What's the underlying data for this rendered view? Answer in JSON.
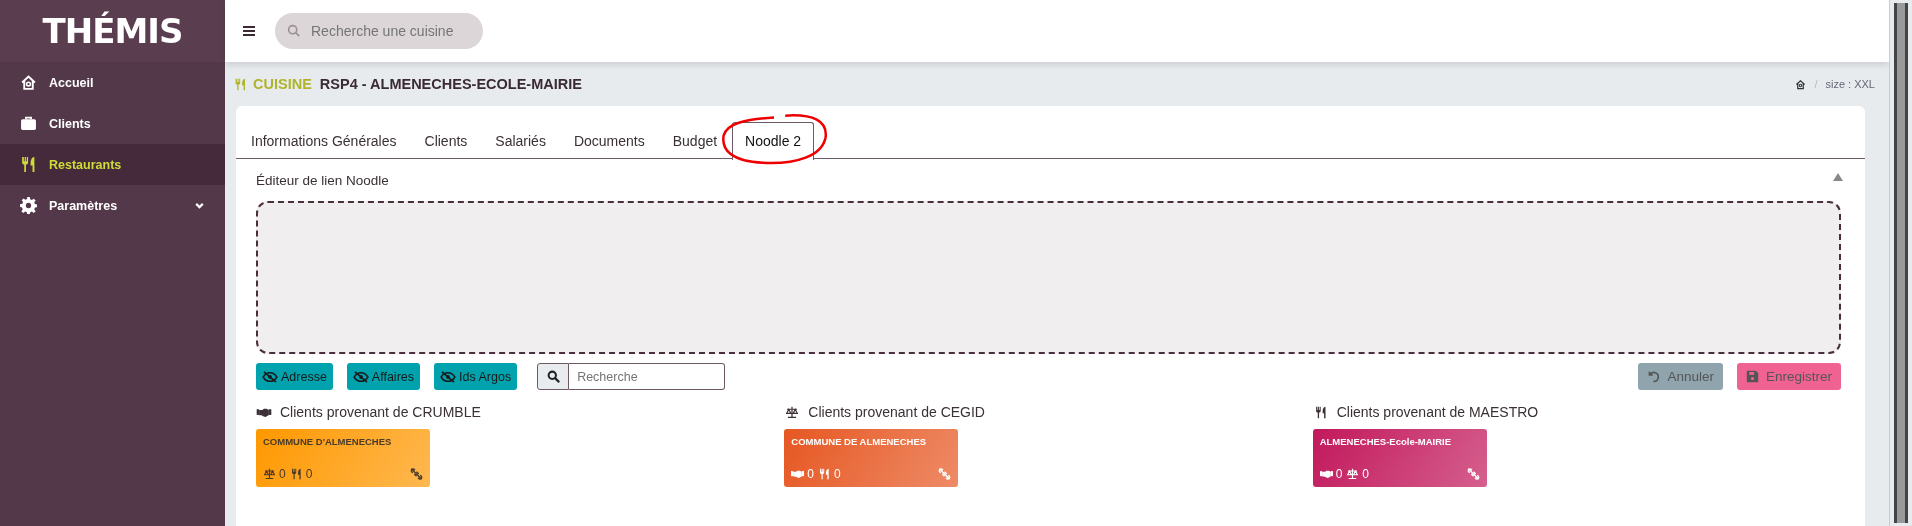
{
  "logo": "THÉMIS",
  "sidebar": {
    "items": [
      {
        "kind": "home",
        "label": "Accueil",
        "selected": false,
        "expandable": false
      },
      {
        "kind": "briefcase",
        "label": "Clients",
        "selected": false,
        "expandable": false
      },
      {
        "kind": "cutlery",
        "label": "Restaurants",
        "selected": true,
        "expandable": false
      },
      {
        "kind": "gear",
        "label": "Paramètres",
        "selected": false,
        "expandable": true
      }
    ]
  },
  "search": {
    "placeholder": "Recherche une cuisine"
  },
  "header": {
    "section": "CUISINE",
    "title": "RSP4 - ALMENECHES-ECOLE-MAIRIE",
    "separator": "/",
    "breadcrumb": "size : XXL"
  },
  "tabs": [
    {
      "label": "Informations Générales",
      "selected": false
    },
    {
      "label": "Clients",
      "selected": false
    },
    {
      "label": "Salariés",
      "selected": false
    },
    {
      "label": "Documents",
      "selected": false
    },
    {
      "label": "Budget",
      "selected": false
    },
    {
      "label": "Noodle 2",
      "selected": true,
      "circled": true
    }
  ],
  "editor": {
    "title": "Éditeur de lien Noodle"
  },
  "toggles": [
    {
      "label": "Adresse"
    },
    {
      "label": "Affaires"
    },
    {
      "label": "Ids Argos"
    }
  ],
  "filter": {
    "placeholder": "Recherche"
  },
  "actions": [
    {
      "kind": "undo",
      "label": "Annuler",
      "disabled": true,
      "color": "#90a4ae"
    },
    {
      "kind": "save",
      "label": "Enregistrer",
      "disabled": true,
      "color": "#f06292"
    }
  ],
  "sources": [
    {
      "kind": "handshake",
      "title": "Clients provenant de CRUMBLE",
      "cards": [
        {
          "name": "COMMUNE D'ALMENECHES",
          "color": "#ff9800",
          "dark_text": true,
          "stats": [
            {
              "kind": "scale",
              "count": "0"
            },
            {
              "kind": "cutlery",
              "count": "0"
            }
          ]
        }
      ]
    },
    {
      "kind": "scale",
      "title": "Clients provenant de CEGID",
      "cards": [
        {
          "name": "COMMUNE DE ALMENECHES",
          "color": "#e65722",
          "dark_text": false,
          "stats": [
            {
              "kind": "handshake",
              "count": "0"
            },
            {
              "kind": "cutlery",
              "count": "0"
            }
          ]
        }
      ]
    },
    {
      "kind": "cutlery",
      "title": "Clients provenant de MAESTRO",
      "cards": [
        {
          "name": "ALMENECHES-Ecole-MAIRIE",
          "color": "#c2185b",
          "dark_text": false,
          "stats": [
            {
              "kind": "handshake",
              "count": "0"
            },
            {
              "kind": "scale",
              "count": "0"
            }
          ]
        }
      ]
    }
  ]
}
